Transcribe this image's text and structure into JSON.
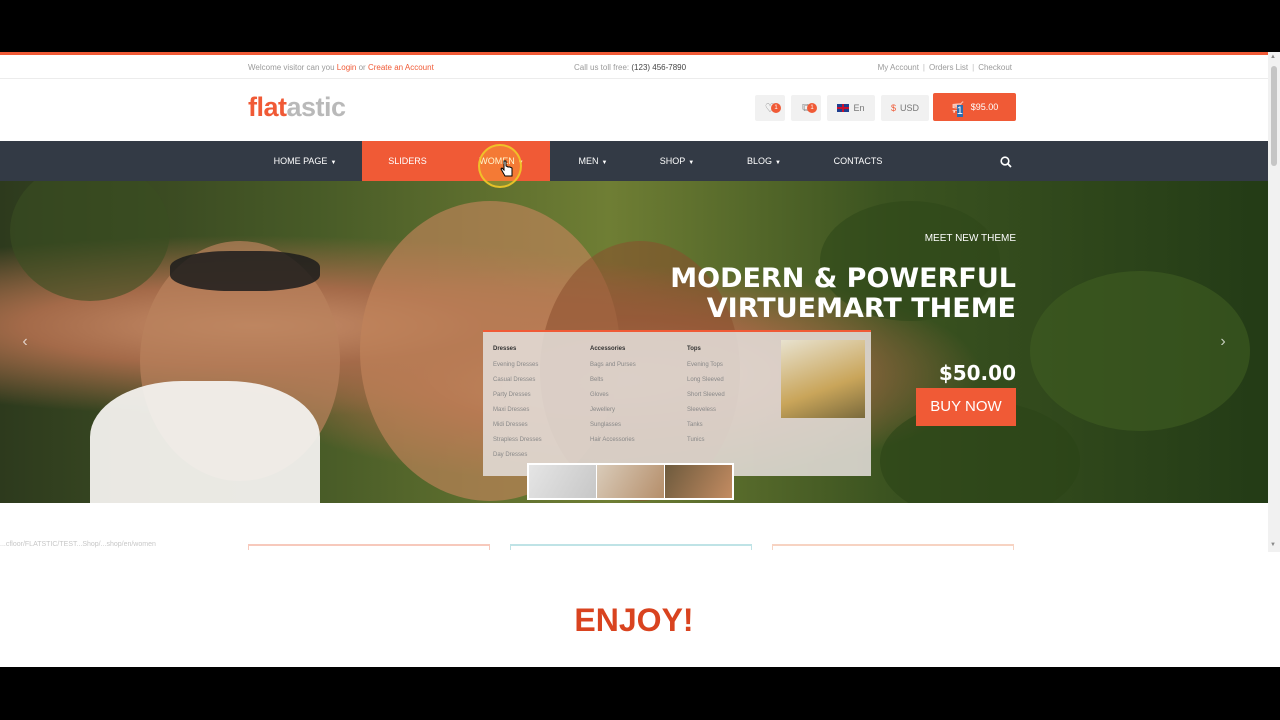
{
  "topbar": {
    "welcome_prefix": "Welcome visitor can you",
    "login": "Login",
    "or": "or",
    "create_account": "Create an Account",
    "phone_label": "Call us toll free:",
    "phone": "(123) 456-7890",
    "my_account": "My Account",
    "orders_list": "Orders List",
    "checkout": "Checkout"
  },
  "header": {
    "logo_a": "flat",
    "logo_b": "astic",
    "wishlist_count": "1",
    "compare_count": "1",
    "language": "En",
    "currency_symbol": "$",
    "currency": "USD",
    "cart_count": "1",
    "cart_total": "$95.00"
  },
  "nav": {
    "items": [
      {
        "label": "HOME PAGE"
      },
      {
        "label": "SLIDERS"
      },
      {
        "label": "WOMEN"
      },
      {
        "label": "MEN"
      },
      {
        "label": "SHOP"
      },
      {
        "label": "BLOG"
      },
      {
        "label": "CONTACTS"
      }
    ]
  },
  "mega_menu": {
    "columns": [
      {
        "title": "Dresses",
        "items": [
          "Evening Dresses",
          "Casual Dresses",
          "Party Dresses",
          "Maxi Dresses",
          "Midi Dresses",
          "Strapless Dresses",
          "Day Dresses"
        ]
      },
      {
        "title": "Accessories",
        "items": [
          "Bags and Purses",
          "Belts",
          "Gloves",
          "Jewellery",
          "Sunglasses",
          "Hair Accessories"
        ]
      },
      {
        "title": "Tops",
        "items": [
          "Evening Tops",
          "Long Sleeved",
          "Short Sleeved",
          "Sleeveless",
          "Tanks",
          "Tunics"
        ]
      }
    ]
  },
  "hero": {
    "kicker": "MEET NEW THEME",
    "title_line1": "MODERN & POWERFUL",
    "title_line2": "VIRTUEMART THEME",
    "price": "$50.00",
    "cta": "BUY NOW"
  },
  "status_url": "...cfloor/FLATSTIC/TEST...Shop/...shop/en/women",
  "enjoy": "ENJOY!",
  "colors": {
    "accent": "#f05a36",
    "nav_bg": "#333a45"
  }
}
